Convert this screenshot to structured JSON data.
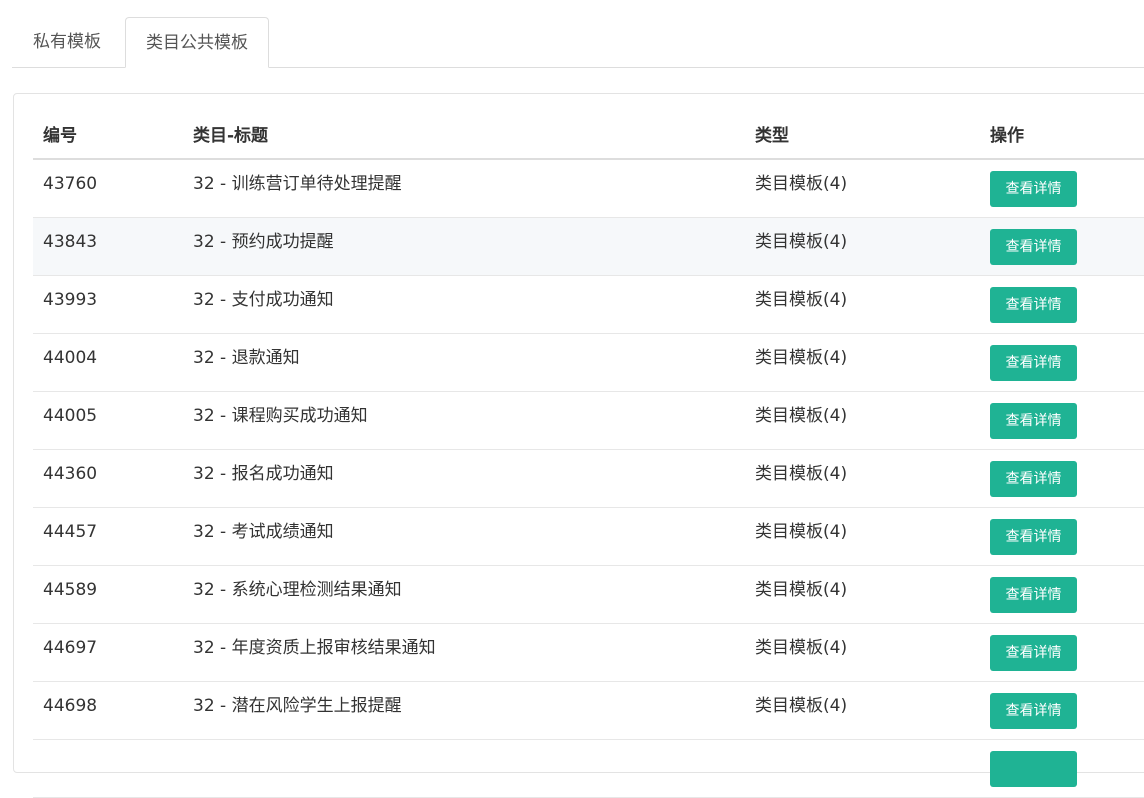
{
  "tabs": [
    {
      "label": "私有模板",
      "active": false
    },
    {
      "label": "类目公共模板",
      "active": true
    }
  ],
  "table": {
    "headers": [
      "编号",
      "类目-标题",
      "类型",
      "操作"
    ],
    "action_label": "查看详情",
    "rows": [
      {
        "id": "43760",
        "title": "32 - 训练营订单待处理提醒",
        "type": "类目模板(4)"
      },
      {
        "id": "43843",
        "title": "32 - 预约成功提醒",
        "type": "类目模板(4)"
      },
      {
        "id": "43993",
        "title": "32 - 支付成功通知",
        "type": "类目模板(4)"
      },
      {
        "id": "44004",
        "title": "32 - 退款通知",
        "type": "类目模板(4)"
      },
      {
        "id": "44005",
        "title": "32 - 课程购买成功通知",
        "type": "类目模板(4)"
      },
      {
        "id": "44360",
        "title": "32 - 报名成功通知",
        "type": "类目模板(4)"
      },
      {
        "id": "44457",
        "title": "32 - 考试成绩通知",
        "type": "类目模板(4)"
      },
      {
        "id": "44589",
        "title": "32 - 系统心理检测结果通知",
        "type": "类目模板(4)"
      },
      {
        "id": "44697",
        "title": "32 - 年度资质上报审核结果通知",
        "type": "类目模板(4)"
      },
      {
        "id": "44698",
        "title": "32 - 潜在风险学生上报提醒",
        "type": "类目模板(4)"
      }
    ]
  },
  "colors": {
    "accent": "#1fb394",
    "row_alt": "#f6f8fa",
    "border": "#dddddd"
  }
}
